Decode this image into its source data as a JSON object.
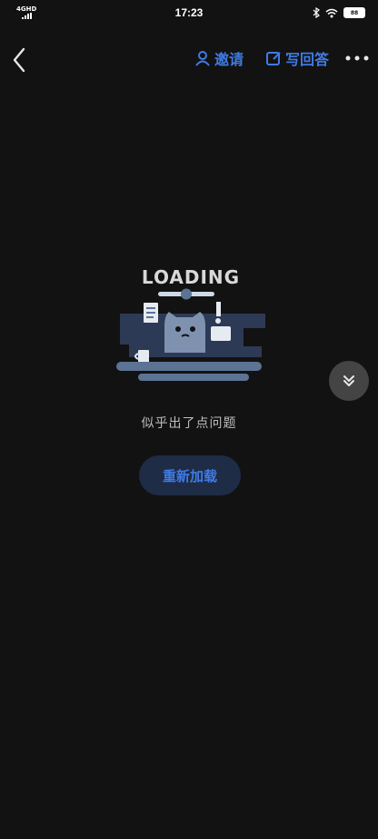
{
  "status_bar": {
    "network": "4GHD",
    "time": "17:23",
    "battery": "88"
  },
  "nav": {
    "invite_label": "邀请",
    "write_answer_label": "写回答"
  },
  "loading_illustration": {
    "text": "LOADING"
  },
  "error": {
    "message": "似乎出了点问题",
    "reload_label": "重新加载"
  },
  "colors": {
    "accent": "#3f7be6",
    "background": "#121212"
  }
}
